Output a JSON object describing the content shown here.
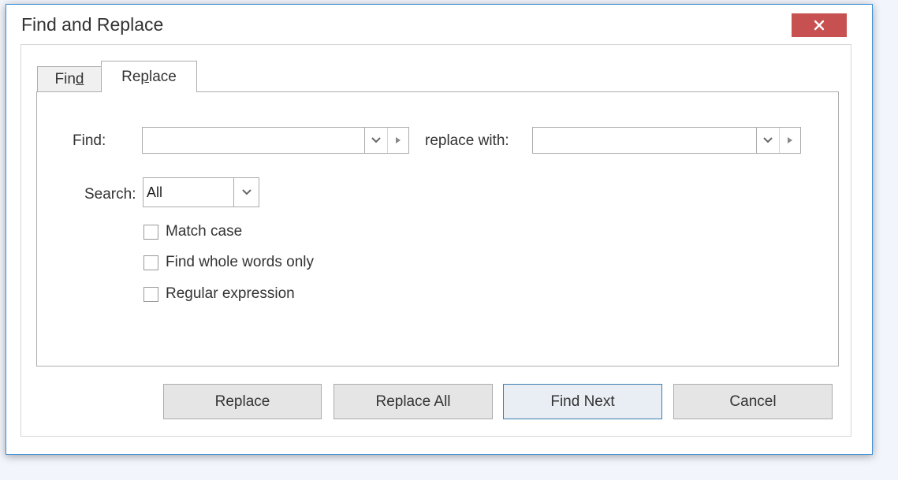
{
  "dialog": {
    "title": "Find and Replace",
    "close_icon": "close-icon"
  },
  "tabs": [
    {
      "label_pre": "Fin",
      "label_mnemonic": "d",
      "label_post": "",
      "selected": false
    },
    {
      "label_pre": "Re",
      "label_mnemonic": "p",
      "label_post": "lace",
      "selected": true
    }
  ],
  "form": {
    "find_label": "Find:",
    "find_value": "",
    "replace_label": "replace with:",
    "replace_value": "",
    "search_label": "Search:",
    "search_value": "All"
  },
  "options": [
    {
      "label": "Match case",
      "checked": false
    },
    {
      "label": "Find whole words only",
      "checked": false
    },
    {
      "label": "Regular expression",
      "checked": false
    }
  ],
  "buttons": {
    "replace": "Replace",
    "replace_all": "Replace All",
    "find_next": "Find Next",
    "cancel": "Cancel"
  },
  "colors": {
    "accent": "#3c8ed8",
    "close": "#c75050"
  }
}
